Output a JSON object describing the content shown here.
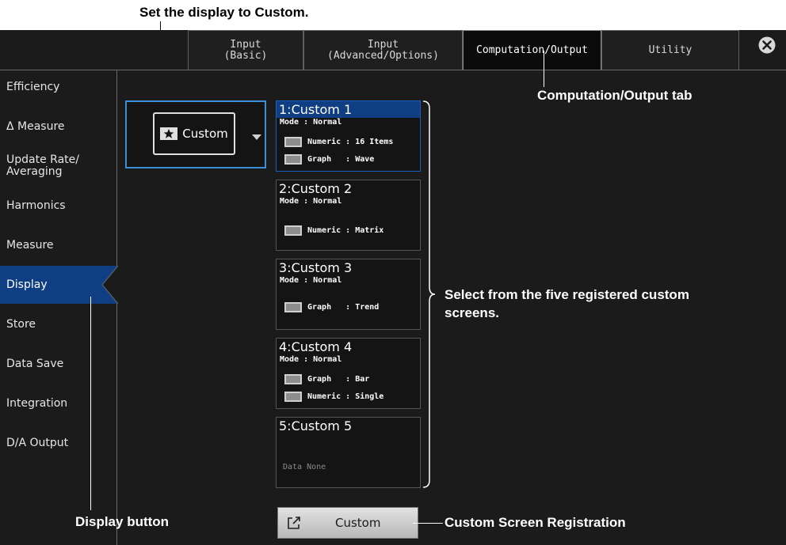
{
  "annotations": {
    "set_display": "Set the display to Custom.",
    "computation_tab": "Computation/Output tab",
    "select_custom_line1": "Select from the five registered custom",
    "select_custom_line2": "screens.",
    "display_button": "Display button",
    "custom_registration": "Custom Screen Registration"
  },
  "tabs": [
    {
      "label": "Input\n(Basic)"
    },
    {
      "label": "Input\n(Advanced/Options)"
    },
    {
      "label": "Computation/Output",
      "active": true
    },
    {
      "label": "Utility"
    }
  ],
  "sidebar": {
    "items": [
      {
        "label": "Efficiency"
      },
      {
        "label": "Δ Measure"
      },
      {
        "label": "Update Rate/\nAveraging"
      },
      {
        "label": "Harmonics"
      },
      {
        "label": "Measure"
      },
      {
        "label": "Display",
        "active": true
      },
      {
        "label": "Store"
      },
      {
        "label": "Data Save"
      },
      {
        "label": "Integration"
      },
      {
        "label": "D/A Output"
      }
    ]
  },
  "display_select": {
    "value": "Custom"
  },
  "custom_screens": [
    {
      "title": "1:Custom 1",
      "mode": "Mode : Normal",
      "rows": [
        "Numeric : 16 Items",
        "Graph   : Wave"
      ]
    },
    {
      "title": "2:Custom 2",
      "mode": "Mode : Normal",
      "rows": [
        "Numeric : Matrix"
      ]
    },
    {
      "title": "3:Custom 3",
      "mode": "Mode : Normal",
      "rows": [
        "Graph   : Trend"
      ]
    },
    {
      "title": "4:Custom 4",
      "mode": "Mode : Normal",
      "rows": [
        "Graph   : Bar",
        "Numeric : Single"
      ]
    },
    {
      "title": "5:Custom 5",
      "none": "Data None"
    }
  ],
  "register_button": {
    "label": "Custom"
  },
  "colors": {
    "accent": "#0f3f82",
    "highlight_border": "#3a8fd8",
    "background": "#1b1b1b"
  },
  "icons": [
    "star-icon",
    "chevron-down-icon",
    "close-icon",
    "external-link-icon"
  ]
}
